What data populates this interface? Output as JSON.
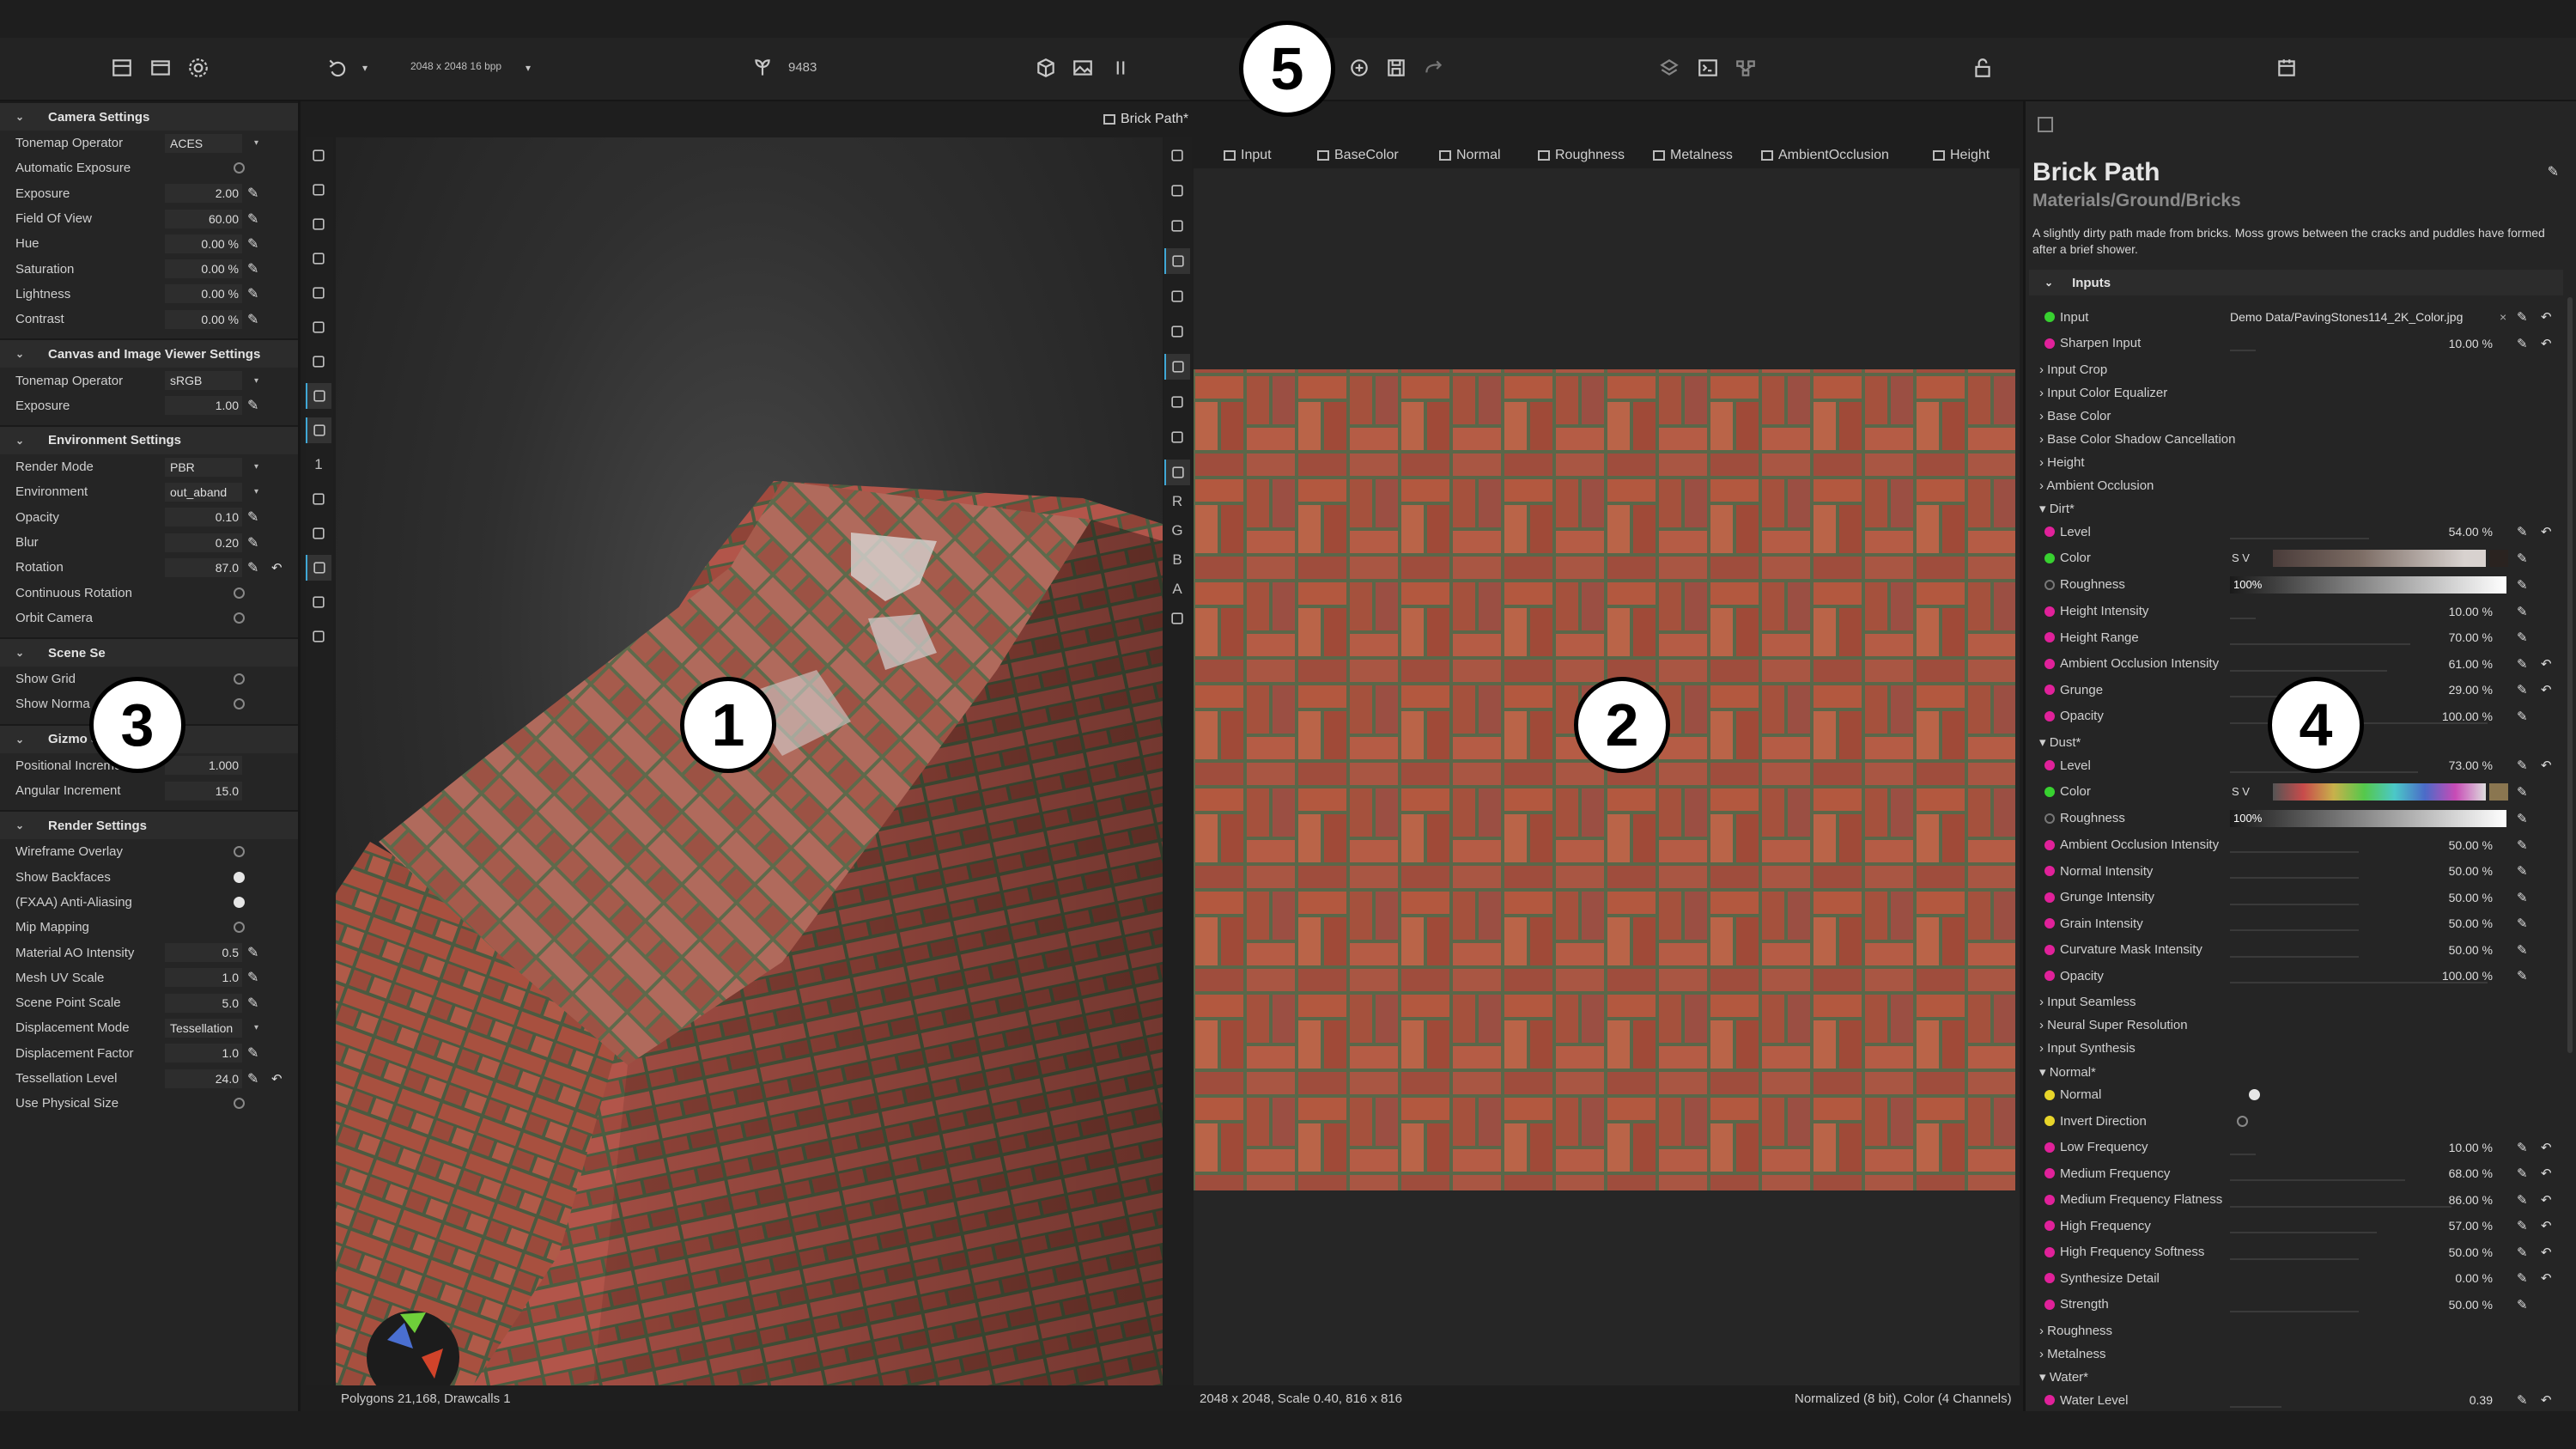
{
  "toolbar": {
    "resolution": "2048 x 2048 16 bpp",
    "seed_value": "9483",
    "icons": [
      "grid-icon",
      "image-frame-icon",
      "gear-icon",
      "undo-icon",
      "chevron-down-icon",
      "seed-icon",
      "cube-icon",
      "image-icon",
      "pause-icon",
      "add-node-icon",
      "save-icon",
      "redo-icon",
      "layers-icon",
      "terminal-icon",
      "node-graph-icon",
      "lock-icon",
      "calendar-icon"
    ]
  },
  "left_panel": {
    "sections": [
      {
        "title": "Camera Settings",
        "rows": [
          {
            "label": "Tonemap Operator",
            "value": "ACES",
            "kind": "dropdown"
          },
          {
            "label": "Automatic Exposure",
            "kind": "toggle",
            "on": false
          },
          {
            "label": "Exposure",
            "value": "2.00",
            "kind": "number"
          },
          {
            "label": "Field Of View",
            "value": "60.00",
            "kind": "number"
          },
          {
            "label": "Hue",
            "value": "0.00 %",
            "kind": "number"
          },
          {
            "label": "Saturation",
            "value": "0.00 %",
            "kind": "number"
          },
          {
            "label": "Lightness",
            "value": "0.00 %",
            "kind": "number"
          },
          {
            "label": "Contrast",
            "value": "0.00 %",
            "kind": "number"
          }
        ]
      },
      {
        "title": "Canvas and Image Viewer Settings",
        "rows": [
          {
            "label": "Tonemap Operator",
            "value": "sRGB",
            "kind": "dropdown"
          },
          {
            "label": "Exposure",
            "value": "1.00",
            "kind": "number"
          }
        ]
      },
      {
        "title": "Environment Settings",
        "rows": [
          {
            "label": "Render Mode",
            "value": "PBR",
            "kind": "dropdown"
          },
          {
            "label": "Environment",
            "value": "out_aband",
            "kind": "dropdown"
          },
          {
            "label": "Opacity",
            "value": "0.10",
            "kind": "number"
          },
          {
            "label": "Blur",
            "value": "0.20",
            "kind": "number"
          },
          {
            "label": "Rotation",
            "value": "87.0",
            "kind": "number",
            "reset": true
          },
          {
            "label": "Continuous Rotation",
            "kind": "toggle",
            "on": false
          },
          {
            "label": "Orbit Camera",
            "kind": "toggle",
            "on": false
          }
        ]
      },
      {
        "title": "Scene Se",
        "rows": [
          {
            "label": "Show Grid",
            "kind": "toggle",
            "on": false
          },
          {
            "label": "Show Norma",
            "kind": "toggle",
            "on": false
          }
        ]
      },
      {
        "title": "Gizmo Settings",
        "rows": [
          {
            "label": "Positional Increment",
            "value": "1.000",
            "kind": "plain"
          },
          {
            "label": "Angular Increment",
            "value": "15.0",
            "kind": "plain"
          }
        ]
      },
      {
        "title": "Render Settings",
        "rows": [
          {
            "label": "Wireframe Overlay",
            "kind": "toggle",
            "on": false
          },
          {
            "label": "Show Backfaces",
            "kind": "toggle",
            "on": true
          },
          {
            "label": "(FXAA) Anti-Aliasing",
            "kind": "toggle",
            "on": true
          },
          {
            "label": "Mip Mapping",
            "kind": "toggle",
            "on": false
          },
          {
            "label": "Material AO Intensity",
            "value": "0.5",
            "kind": "number"
          },
          {
            "label": "Mesh UV Scale",
            "value": "1.0",
            "kind": "number"
          },
          {
            "label": "Scene Point Scale",
            "value": "5.0",
            "kind": "number"
          },
          {
            "label": "Displacement Mode",
            "value": "Tessellation",
            "kind": "dropdown"
          },
          {
            "label": "Displacement Factor",
            "value": "1.0",
            "kind": "number"
          },
          {
            "label": "Tessellation Level",
            "value": "24.0",
            "kind": "number",
            "reset": true
          },
          {
            "label": "Use Physical Size",
            "kind": "toggle",
            "on": false
          }
        ]
      }
    ]
  },
  "viewport3d": {
    "status": "Polygons 21,168, Drawcalls 1",
    "side_icons": [
      "move-icon",
      "rotate-icon",
      "scale-icon",
      "sphere-icon",
      "save-icon",
      "clipboard-icon",
      "target-icon",
      "ground-icon",
      "eye-icon",
      "1",
      "checker-icon",
      "camera-icon",
      "terrain-icon",
      "monitor-icon",
      "cube-icon"
    ]
  },
  "viewport2d": {
    "title": "Brick Path*",
    "tabs": [
      "Input",
      "BaseColor",
      "Normal",
      "Roughness",
      "Metalness",
      "AmbientOcclusion",
      "Height"
    ],
    "status_left": "2048 x 2048, Scale 0.40, 816 x 816",
    "status_right": "Normalized (8 bit), Color (4 Channels)",
    "side_icons": [
      "save-icon",
      "clipboard-icon",
      "target-icon",
      "fit-icon",
      "square-icon",
      "pen-icon",
      "checker-icon",
      "grid-icon",
      "filter-icon",
      "light-icon",
      "R",
      "G",
      "B",
      "A",
      "strip-icon"
    ]
  },
  "right_panel": {
    "title": "Brick Path",
    "subtitle": "Materials/Ground/Bricks",
    "description": "A slightly dirty path made from bricks. Moss grows between the cracks and puddles have formed after a brief shower.",
    "inputs_header": "Inputs",
    "input_file": "Demo Data/PavingStones114_2K_Color.jpg",
    "rows": [
      {
        "type": "param",
        "dot": "green",
        "label": "Input",
        "value": "",
        "file": true
      },
      {
        "type": "param",
        "dot": "pink",
        "label": "Sharpen Input",
        "value": "10.00 %",
        "fill": 0.1,
        "reset": true
      },
      {
        "type": "group",
        "label": "Input Crop"
      },
      {
        "type": "group",
        "label": "Input Color Equalizer"
      },
      {
        "type": "group",
        "label": "Base Color"
      },
      {
        "type": "group",
        "label": "Base Color Shadow Cancellation"
      },
      {
        "type": "group",
        "label": "Height"
      },
      {
        "type": "group",
        "label": "Ambient Occlusion"
      },
      {
        "type": "group",
        "label": "Dirt*",
        "open": true
      },
      {
        "type": "param",
        "dot": "pink",
        "label": "Level",
        "value": "54.00 %",
        "fill": 0.54,
        "reset": true
      },
      {
        "type": "color",
        "dot": "green",
        "label": "Color",
        "swatch": "#2a2320"
      },
      {
        "type": "gray",
        "dot": "hollow",
        "label": "Roughness",
        "value": "100%"
      },
      {
        "type": "param",
        "dot": "pink",
        "label": "Height Intensity",
        "value": "10.00 %",
        "fill": 0.1
      },
      {
        "type": "param",
        "dot": "pink",
        "label": "Height Range",
        "value": "70.00 %",
        "fill": 0.7
      },
      {
        "type": "param",
        "dot": "pink",
        "label": "Ambient Occlusion Intensity",
        "value": "61.00 %",
        "fill": 0.61,
        "reset": true
      },
      {
        "type": "param",
        "dot": "pink",
        "label": "Grunge",
        "value": "29.00 %",
        "fill": 0.29,
        "reset": true
      },
      {
        "type": "param",
        "dot": "pink",
        "label": "Opacity",
        "value": "100.00 %",
        "fill": 1.0
      },
      {
        "type": "group",
        "label": "Dust*",
        "open": true
      },
      {
        "type": "param",
        "dot": "pink",
        "label": "Level",
        "value": "73.00 %",
        "fill": 0.73,
        "reset": true
      },
      {
        "type": "color",
        "dot": "green",
        "label": "Color",
        "swatch": "#8a7650"
      },
      {
        "type": "gray",
        "dot": "hollow",
        "label": "Roughness",
        "value": "100%"
      },
      {
        "type": "param",
        "dot": "pink",
        "label": "Ambient Occlusion Intensity",
        "value": "50.00 %",
        "fill": 0.5
      },
      {
        "type": "param",
        "dot": "pink",
        "label": "Normal Intensity",
        "value": "50.00 %",
        "fill": 0.5
      },
      {
        "type": "param",
        "dot": "pink",
        "label": "Grunge Intensity",
        "value": "50.00 %",
        "fill": 0.5
      },
      {
        "type": "param",
        "dot": "pink",
        "label": "Grain Intensity",
        "value": "50.00 %",
        "fill": 0.5
      },
      {
        "type": "param",
        "dot": "pink",
        "label": "Curvature Mask Intensity",
        "value": "50.00 %",
        "fill": 0.5
      },
      {
        "type": "param",
        "dot": "pink",
        "label": "Opacity",
        "value": "100.00 %",
        "fill": 1.0
      },
      {
        "type": "group",
        "label": "Input Seamless"
      },
      {
        "type": "group",
        "label": "Neural Super Resolution"
      },
      {
        "type": "group",
        "label": "Input Synthesis"
      },
      {
        "type": "group",
        "label": "Normal*",
        "open": true
      },
      {
        "type": "toggle",
        "dot": "ylw",
        "label": "Normal",
        "on": true
      },
      {
        "type": "toggle",
        "dot": "ylw",
        "label": "Invert Direction",
        "on": false
      },
      {
        "type": "param",
        "dot": "pink",
        "label": "Low Frequency",
        "value": "10.00 %",
        "fill": 0.1,
        "reset": true
      },
      {
        "type": "param",
        "dot": "pink",
        "label": "Medium Frequency",
        "value": "68.00 %",
        "fill": 0.68,
        "reset": true
      },
      {
        "type": "param",
        "dot": "pink",
        "label": "Medium Frequency Flatness",
        "value": "86.00 %",
        "fill": 0.86,
        "reset": true
      },
      {
        "type": "param",
        "dot": "pink",
        "label": "High Frequency",
        "value": "57.00 %",
        "fill": 0.57,
        "reset": true
      },
      {
        "type": "param",
        "dot": "pink",
        "label": "High Frequency Softness",
        "value": "50.00 %",
        "fill": 0.5,
        "reset": true
      },
      {
        "type": "param",
        "dot": "pink",
        "label": "Synthesize Detail",
        "value": "0.00 %",
        "fill": 0.0,
        "reset": true
      },
      {
        "type": "param",
        "dot": "pink",
        "label": "Strength",
        "value": "50.00 %",
        "fill": 0.5
      },
      {
        "type": "group",
        "label": "Roughness"
      },
      {
        "type": "group",
        "label": "Metalness"
      },
      {
        "type": "group",
        "label": "Water*",
        "open": true
      },
      {
        "type": "param",
        "dot": "pink",
        "label": "Water Level",
        "value": "0.39",
        "fill": 0.2,
        "reset": true
      }
    ]
  },
  "callouts": [
    "1",
    "2",
    "3",
    "4",
    "5"
  ],
  "colors": {
    "accent": "#3fa7d6",
    "param_dot": "#e0219a",
    "input_dot": "#38d130",
    "toggle_dot": "#e8d52a",
    "brick": "#b0573f",
    "mortar": "#5d6a45"
  }
}
